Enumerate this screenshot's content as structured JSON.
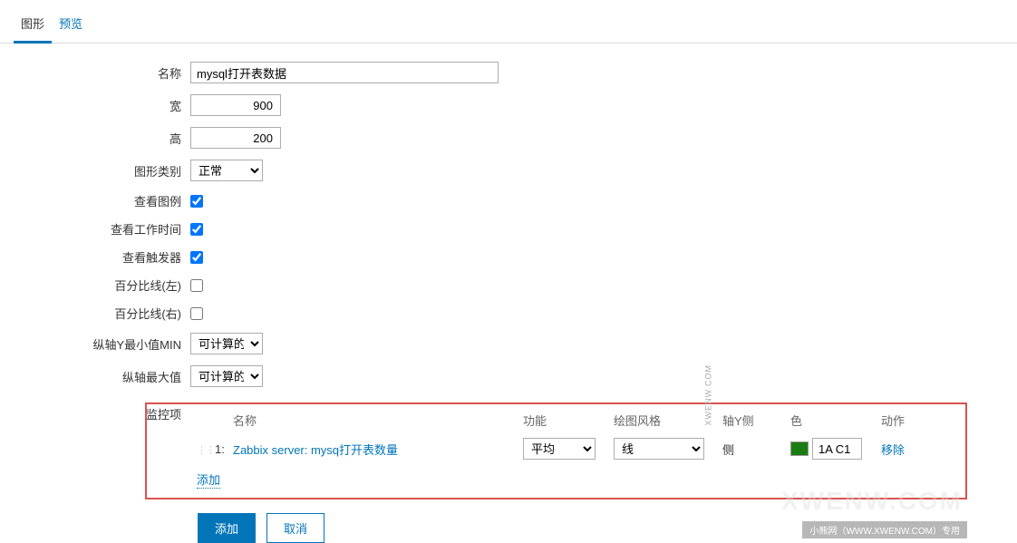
{
  "tabs": {
    "graphic": "图形",
    "preview": "预览"
  },
  "labels": {
    "name": "名称",
    "width": "宽",
    "height": "高",
    "graph_type": "图形类别",
    "show_legend": "查看图例",
    "show_work_time": "查看工作时间",
    "show_triggers": "查看触发器",
    "percent_left": "百分比线(左)",
    "percent_right": "百分比线(右)",
    "yaxis_min": "纵轴Y最小值MIN",
    "yaxis_max": "纵轴最大值",
    "items": "监控项"
  },
  "values": {
    "name": "mysql打开表数据",
    "width": "900",
    "height": "200",
    "graph_type": "正常",
    "yaxis_min": "可计算的",
    "yaxis_max": "可计算的"
  },
  "checkboxes": {
    "show_legend": true,
    "show_work_time": true,
    "show_triggers": true,
    "percent_left": false,
    "percent_right": false
  },
  "items_table": {
    "headers": {
      "name": "名称",
      "function": "功能",
      "draw_style": "绘图风格",
      "yaxis_side": "轴Y侧",
      "color": "色",
      "action": "动作"
    },
    "rows": [
      {
        "num": "1:",
        "name": "Zabbix server: mysq打开表数量",
        "function": "平均",
        "draw_style": "线",
        "yaxis_side": "侧",
        "color": "1A C1",
        "action": "移除"
      }
    ],
    "add_link": "添加"
  },
  "buttons": {
    "add": "添加",
    "cancel": "取消"
  },
  "watermark": {
    "main": "XWENW.COM",
    "footer": "小熊网（WWW.XWENW.COM）专用",
    "side": "XWENW.COM"
  }
}
